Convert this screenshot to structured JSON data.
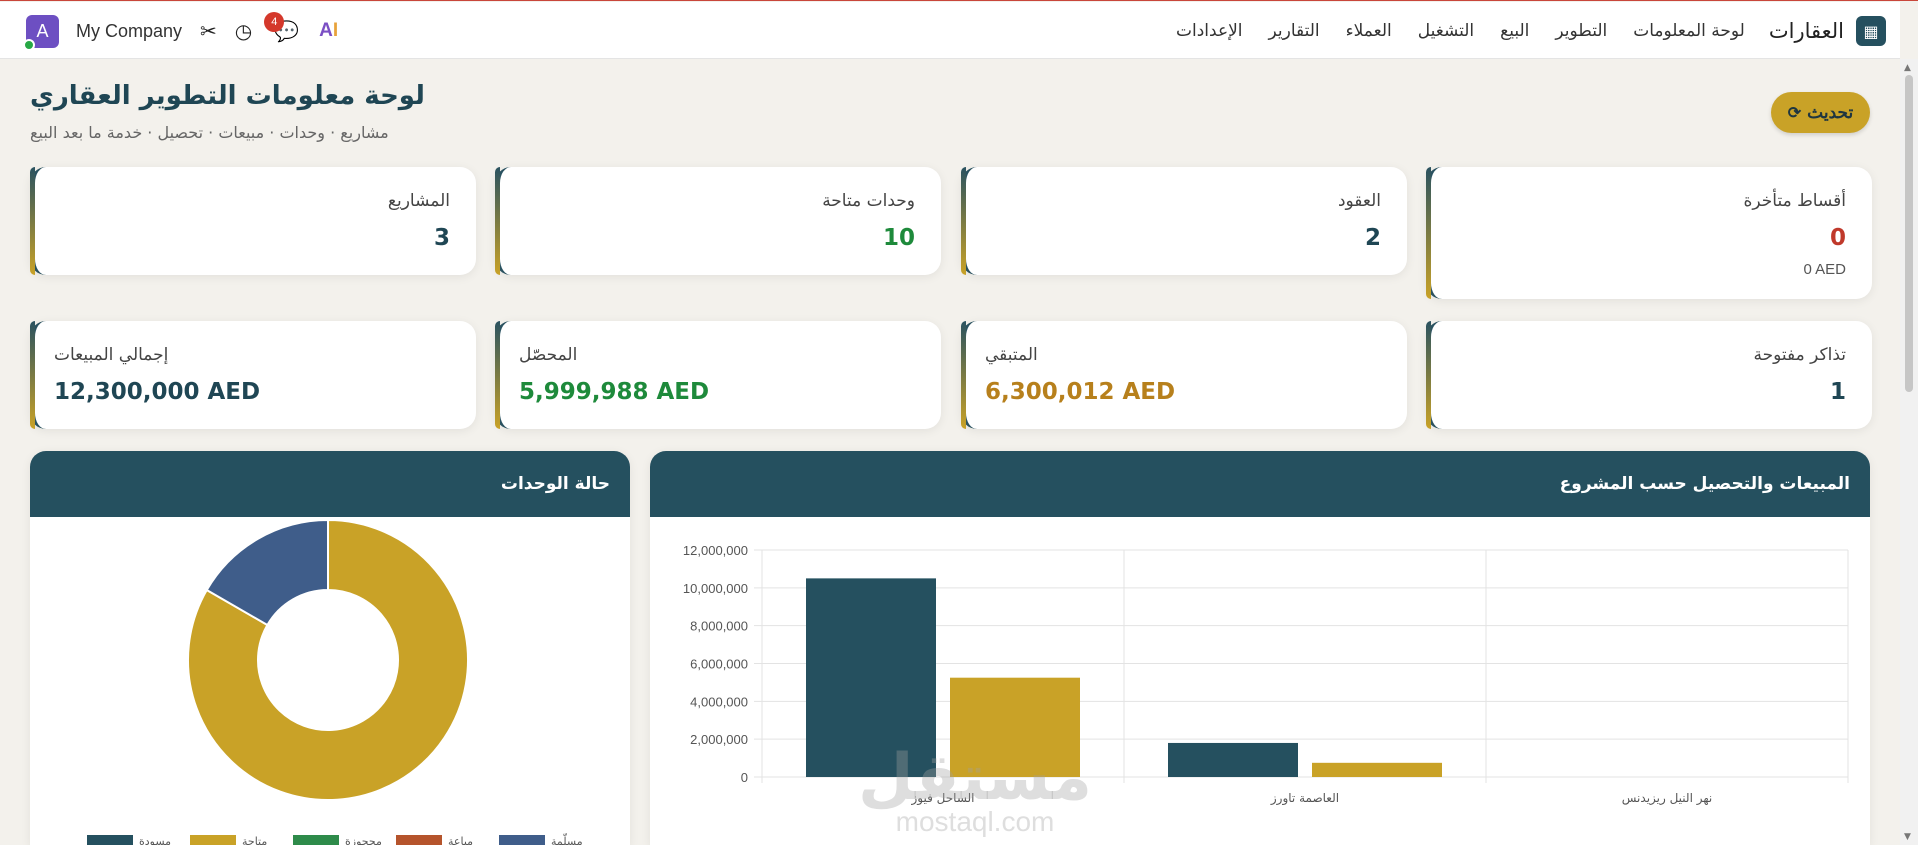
{
  "navbar": {
    "avatar_letter": "A",
    "company": "My Company",
    "chat_badge": "4",
    "ai_a": "A",
    "ai_i": "I",
    "brand": "العقارات",
    "menu": [
      "لوحة المعلومات",
      "التطوير",
      "البيع",
      "التشغيل",
      "العملاء",
      "التقارير",
      "الإعدادات"
    ]
  },
  "header": {
    "title": "لوحة معلومات التطوير العقاري",
    "subtitle": "مشاريع · وحدات · مبيعات · تحصيل · خدمة ما بعد البيع",
    "refresh_label": "تحديث"
  },
  "kpis": {
    "overdue": {
      "label": "أقساط متأخرة",
      "value": "0",
      "sub": "0 AED",
      "color": "#c0392b"
    },
    "contracts": {
      "label": "العقود",
      "value": "2",
      "color": "#1f4654"
    },
    "available": {
      "label": "وحدات متاحة",
      "value": "10",
      "color": "#1e8a3b"
    },
    "projects": {
      "label": "المشاريع",
      "value": "3",
      "color": "#1f4654"
    },
    "tickets": {
      "label": "تذاكر مفتوحة",
      "value": "1",
      "color": "#1f4654"
    },
    "remaining": {
      "label": "المتبقي",
      "value": "6,300,012 AED",
      "color": "#b7801c"
    },
    "collected": {
      "label": "المحصّل",
      "value": "5,999,988 AED",
      "color": "#1e8a3b"
    },
    "total_sales": {
      "label": "إجمالي المبيعات",
      "value": "12,300,000 AED",
      "color": "#1f4654"
    }
  },
  "panels": {
    "sales_title": "المبيعات والتحصيل حسب المشروع",
    "units_title": "حالة الوحدات"
  },
  "watermark": {
    "ar": "مستقل",
    "en": "mostaql.com"
  },
  "chart_data": [
    {
      "type": "bar",
      "title": "المبيعات والتحصيل حسب المشروع",
      "categories": [
        "الساحل فيوز",
        "العاصمة تاورز",
        "نهر النيل ريزيدنس"
      ],
      "series": [
        {
          "values": [
            10500000,
            1800000,
            0
          ],
          "color": "#25505f"
        },
        {
          "values": [
            5250000,
            750000,
            0
          ],
          "color": "#c9a227"
        }
      ],
      "y_ticks": [
        "0",
        "2,000,000",
        "4,000,000",
        "6,000,000",
        "8,000,000",
        "10,000,000",
        "12,000,000"
      ],
      "ylim": [
        0,
        12000000
      ],
      "grid": true
    },
    {
      "type": "pie",
      "title": "حالة الوحدات",
      "labels": [
        "مسودة",
        "متاحة",
        "محجوزة",
        "مباعة",
        "مسلّمة"
      ],
      "colors": [
        "#25505f",
        "#c9a227",
        "#2e8b4a",
        "#b5542c",
        "#3f5d8a"
      ],
      "values": [
        0,
        10,
        0,
        0,
        2
      ]
    }
  ]
}
